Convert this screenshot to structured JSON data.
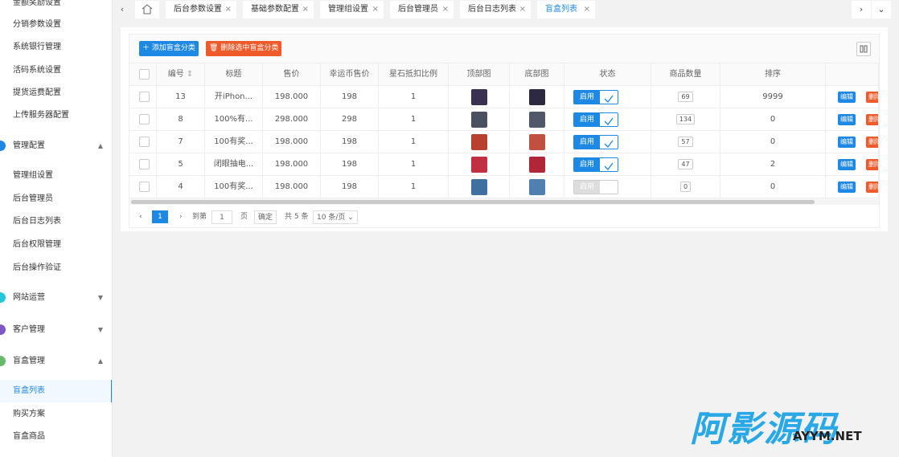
{
  "sidebar": {
    "top_items": [
      "金额奖励设置",
      "分销参数设置",
      "系统银行管理",
      "活码系统设置",
      "提货运费配置",
      "上传服务器配置"
    ],
    "groups": [
      {
        "label": "管理配置",
        "color": "#1e88e5",
        "arrow": "▲"
      },
      {
        "label": "网站运营",
        "color": "#26c6da",
        "arrow": "▼"
      },
      {
        "label": "客户管理",
        "color": "#7e57c2",
        "arrow": "▼"
      },
      {
        "label": "盲盒管理",
        "color": "#66bb6a",
        "arrow": "▲"
      }
    ],
    "admin_items": [
      "管理组设置",
      "后台管理员",
      "后台日志列表",
      "后台权限管理",
      "后台操作验证"
    ],
    "blindbox_items": [
      "盲盒列表",
      "购买方案",
      "盲盒商品"
    ]
  },
  "tabs": [
    {
      "label": "后台参数设置"
    },
    {
      "label": "基础参数配置"
    },
    {
      "label": "管理组设置"
    },
    {
      "label": "后台管理员"
    },
    {
      "label": "后台日志列表"
    },
    {
      "label": "盲盒列表"
    }
  ],
  "toolbar": {
    "add_label": "添加盲盒分类",
    "delete_label": "删除选中盲盒分类"
  },
  "table": {
    "headers": [
      "编号",
      "标题",
      "售价",
      "幸运币售价",
      "星石抵扣比例",
      "顶部图",
      "底部图",
      "状态",
      "商品数量",
      "排序"
    ],
    "switch_on_label": "启用",
    "edit_label": "编辑",
    "del_label": "删除",
    "rows": [
      {
        "id": "13",
        "title": "开iPhon...",
        "price": "198.000",
        "coin": "198",
        "ratio": "1",
        "status": "on",
        "qty": "69",
        "sort": "9999",
        "img_top": "#3a3050",
        "img_bottom": "#2b2a40"
      },
      {
        "id": "8",
        "title": "100%有...",
        "price": "298.000",
        "coin": "298",
        "ratio": "1",
        "status": "on",
        "qty": "134",
        "sort": "0",
        "img_top": "#4a5060",
        "img_bottom": "#50586a"
      },
      {
        "id": "7",
        "title": "100有奖...",
        "price": "198.000",
        "coin": "198",
        "ratio": "1",
        "status": "on",
        "qty": "57",
        "sort": "0",
        "img_top": "#b84030",
        "img_bottom": "#c05040"
      },
      {
        "id": "5",
        "title": "闭眼抽电...",
        "price": "198.000",
        "coin": "198",
        "ratio": "1",
        "status": "on",
        "qty": "47",
        "sort": "2",
        "img_top": "#c03040",
        "img_bottom": "#b02838"
      },
      {
        "id": "4",
        "title": "100有奖...",
        "price": "198.000",
        "coin": "198",
        "ratio": "1",
        "status": "off",
        "qty": "0",
        "sort": "0",
        "img_top": "#4070a0",
        "img_bottom": "#5080b0"
      }
    ]
  },
  "pager": {
    "current": "1",
    "goto_label": "到第",
    "page_value": "1",
    "page_unit": "页",
    "confirm": "确定",
    "total": "共 5 条",
    "per_page": "10 条/页"
  },
  "watermark": {
    "main": "阿影源码",
    "sub": "AYYM.NET"
  },
  "colors": {
    "accent": "#1e88e5",
    "danger": "#ef5a2b"
  }
}
